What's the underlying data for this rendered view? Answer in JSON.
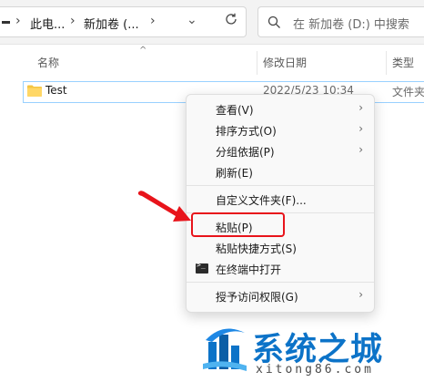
{
  "address_bar": {
    "crumbs": [
      "此电...",
      "新加卷 (..."
    ],
    "search_placeholder": "在 新加卷 (D:) 中搜索"
  },
  "columns": {
    "name": "名称",
    "date": "修改日期",
    "type": "类型"
  },
  "files": [
    {
      "name": "Test",
      "date": "2022/5/23 10:34",
      "type": "文件夹"
    }
  ],
  "context_menu": {
    "items": [
      {
        "label": "查看(V)",
        "submenu": true
      },
      {
        "label": "排序方式(O)",
        "submenu": true
      },
      {
        "label": "分组依据(P)",
        "submenu": true
      },
      {
        "label": "刷新(E)",
        "submenu": false
      },
      {
        "label": "自定义文件夹(F)...",
        "submenu": false
      },
      {
        "label": "粘贴(P)",
        "submenu": false
      },
      {
        "label": "粘贴快捷方式(S)",
        "submenu": false
      },
      {
        "label": "在终端中打开",
        "submenu": false,
        "icon": "terminal-icon"
      },
      {
        "label": "授予访问权限(G)",
        "submenu": true
      }
    ]
  },
  "watermark": {
    "title": "系统之城",
    "url": "xitong86.com"
  },
  "colors": {
    "highlight": "#e8141b",
    "watermark_blue": "#0c73c8",
    "folder": "#f5c542"
  }
}
